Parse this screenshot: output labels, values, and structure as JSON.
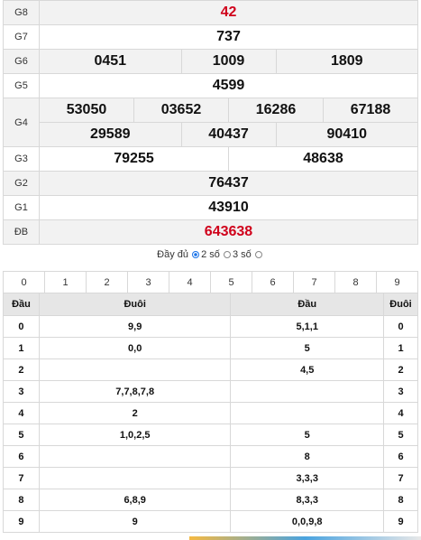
{
  "results": {
    "g8": {
      "label": "G8",
      "value": "42"
    },
    "g7": {
      "label": "G7",
      "value": "737"
    },
    "g6": {
      "label": "G6",
      "values": [
        "0451",
        "1009",
        "1809"
      ]
    },
    "g5": {
      "label": "G5",
      "value": "4599"
    },
    "g4": {
      "label": "G4",
      "row1": [
        "53050",
        "03652",
        "16286",
        "67188"
      ],
      "row2": [
        "29589",
        "40437",
        "90410"
      ]
    },
    "g3": {
      "label": "G3",
      "values": [
        "79255",
        "48638"
      ]
    },
    "g2": {
      "label": "G2",
      "value": "76437"
    },
    "g1": {
      "label": "G1",
      "value": "43910"
    },
    "db": {
      "label": "ĐB",
      "value": "643638"
    }
  },
  "mode": {
    "full": "Đầy đủ",
    "two": "2 số",
    "three": "3 số",
    "selected": "two"
  },
  "digits": [
    "0",
    "1",
    "2",
    "3",
    "4",
    "5",
    "6",
    "7",
    "8",
    "9"
  ],
  "loto": {
    "headers": [
      "Đầu",
      "Đuôi",
      "Đầu",
      "Đuôi"
    ],
    "rows": [
      [
        "0",
        "9,9",
        "5,1,1",
        "0"
      ],
      [
        "1",
        "0,0",
        "5",
        "1"
      ],
      [
        "2",
        "",
        "4,5",
        "2"
      ],
      [
        "3",
        "7,7,8,7,8",
        "",
        "3"
      ],
      [
        "4",
        "2",
        "",
        "4"
      ],
      [
        "5",
        "1,0,2,5",
        "5",
        "5"
      ],
      [
        "6",
        "",
        "8",
        "6"
      ],
      [
        "7",
        "",
        "3,3,3",
        "7"
      ],
      [
        "8",
        "6,8,9",
        "8,3,3",
        "8"
      ],
      [
        "9",
        "9",
        "0,0,9,8",
        "9"
      ]
    ]
  },
  "colors": {
    "special": "#d0021b",
    "g8": "#d0021b",
    "header_bg": "#e6e6e6",
    "alt_bg": "#f2f2f2"
  }
}
